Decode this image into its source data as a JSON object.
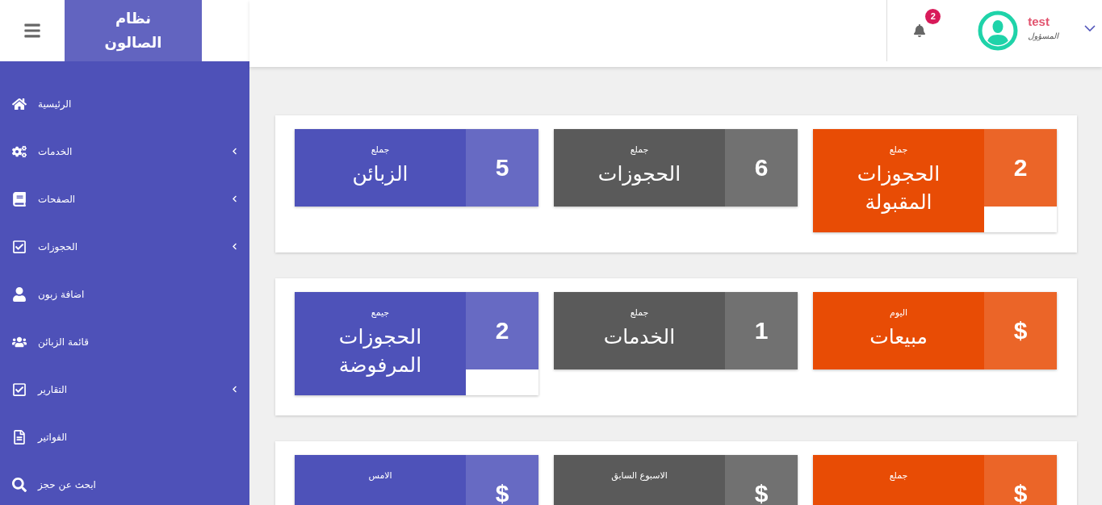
{
  "header": {
    "logo": "نظام الصالون",
    "notifications": {
      "count": "2"
    },
    "user": {
      "name": "test",
      "role": "المسؤول"
    }
  },
  "sidebar": {
    "items": [
      {
        "label": "الرئيسية",
        "expandable": false
      },
      {
        "label": "الخدمات",
        "expandable": true
      },
      {
        "label": "الصفحات",
        "expandable": true
      },
      {
        "label": "الحجوزات",
        "expandable": true
      },
      {
        "label": "اضافة زبون",
        "expandable": false
      },
      {
        "label": "قائمة الزبائن",
        "expandable": false
      },
      {
        "label": "التقارير",
        "expandable": true
      },
      {
        "label": "الفواتير",
        "expandable": false
      },
      {
        "label": "ابحث عن حجز",
        "expandable": false
      }
    ]
  },
  "panels": [
    {
      "cards": [
        {
          "label": "جملع",
          "title": "الحجوزات المقبولة",
          "value": "2",
          "color": "#e84c05"
        },
        {
          "label": "جملع",
          "title": "الحجوزات",
          "value": "6",
          "color": "#5a5a5a"
        },
        {
          "label": "جملع",
          "title": "الزبائن",
          "value": "5",
          "color": "#4e52b9"
        }
      ]
    },
    {
      "cards": [
        {
          "label": "اليوم",
          "title": "مبيعات",
          "value": "$",
          "color": "#e84c05"
        },
        {
          "label": "جملع",
          "title": "الخدمات",
          "value": "1",
          "color": "#5a5a5a"
        },
        {
          "label": "جيمع",
          "title": "الحجوزات المرفوضة",
          "value": "2",
          "color": "#4e52b9"
        }
      ]
    },
    {
      "cards": [
        {
          "label": "جملع",
          "value": "$",
          "color": "#e84c05"
        },
        {
          "label": "الاسبوع السابق",
          "value": "$",
          "color": "#5a5a5a"
        },
        {
          "label": "الامس",
          "value": "$",
          "color": "#4e52b9"
        }
      ]
    }
  ]
}
